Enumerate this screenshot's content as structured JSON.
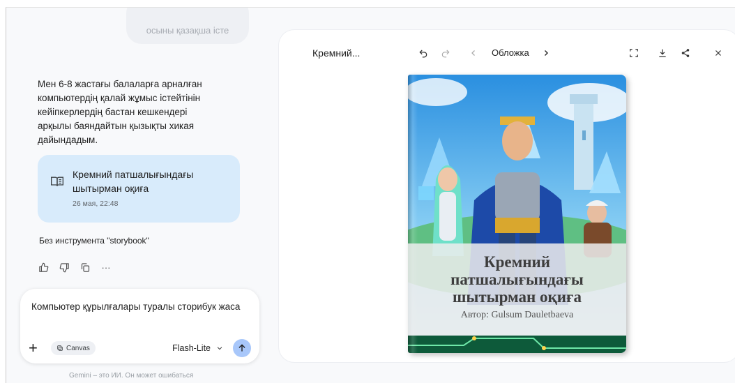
{
  "chat": {
    "top_user_message": "осыны қазақша істе",
    "reply_text": "Мен 6-8 жастағы балаларға арналған компьютердің қалай жұмыс істейтінін кейіпкерлердің бастан кешкендері арқылы баяндайтын қызықты хикая дайындадым.",
    "document_card": {
      "icon": "book-open-icon",
      "title": "Кремний патшалығындағы шытырман оқиға",
      "date": "26 мая, 22:48"
    },
    "tool_note": "Без инструмента \"storybook\"",
    "actions": [
      "thumb-up-icon",
      "thumb-down-icon",
      "copy-icon",
      "more-icon"
    ],
    "more_label": "···"
  },
  "composer": {
    "text": "Компьютер құрылғалары туралы сторибук жаса",
    "plus_label": "+",
    "canvas_label": "Canvas",
    "model_label": "Flash-Lite",
    "disclaimer": "Gemini – это ИИ. Он может ошибаться"
  },
  "panel": {
    "title": "Кремний...",
    "nav_label": "Обложка",
    "book": {
      "title": "Кремний патшалығындағы шытырман оқиға",
      "author": "Автор: Gulsum Dauletbaeva"
    }
  },
  "colors": {
    "card_bg": "#d8ebfb",
    "send_bg": "#a8c7fa",
    "panel_bg": "#ffffff"
  }
}
